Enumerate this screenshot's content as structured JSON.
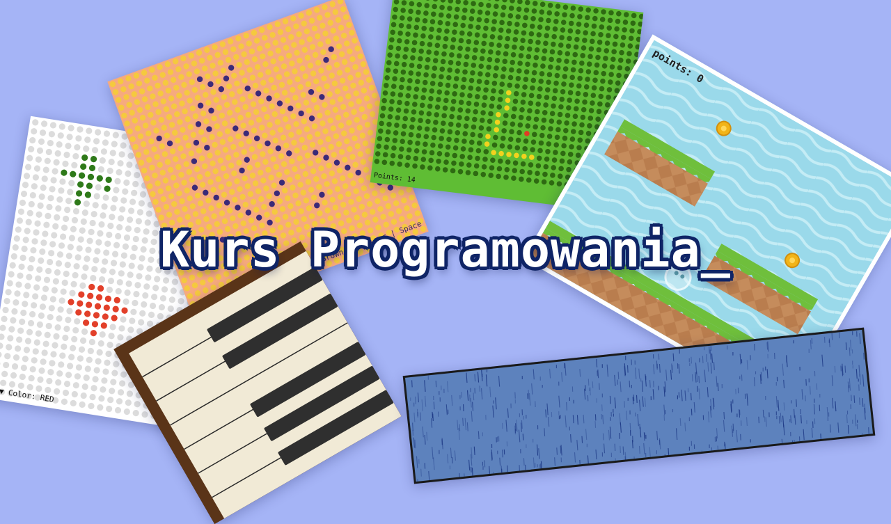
{
  "title": "Kurs Programowania_",
  "panels": {
    "white_canvas": {
      "status": "▲/▼ Color: RED"
    },
    "orange_canvas": {
      "status": "← Color: Brown | ← Clear | Space"
    },
    "snake": {
      "score": "Points: 14"
    },
    "platformer": {
      "score": "points: 0"
    }
  },
  "colors": {
    "background": "#a5b4f6",
    "title_fill": "#ffffff",
    "title_outline": "#0f2466",
    "white_dot": "#dcdcdc",
    "orange_dot": "#f5c93e",
    "orange_drawn": "#3b2a78",
    "green_bg": "#5fbd34",
    "green_dot": "#2e6a12",
    "snake_body": "#f2d21e",
    "snake_food": "#e03b24",
    "rain_bg": "#5d82bd",
    "rain_drop": "#1e3a86"
  },
  "icons": [
    "coin-icon",
    "bubble-player-icon"
  ]
}
